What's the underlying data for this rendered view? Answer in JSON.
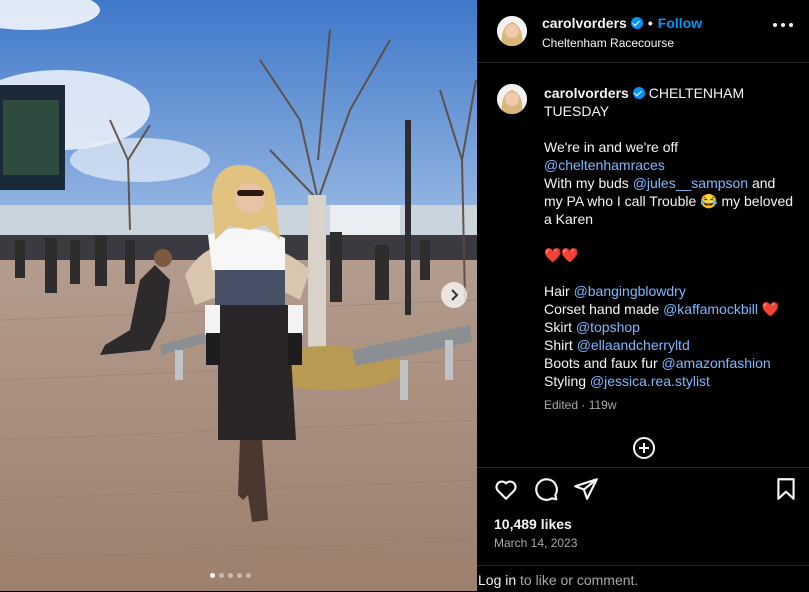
{
  "post": {
    "username": "carolvorders",
    "follow_label": "Follow",
    "separator": "•",
    "location": "Cheltenham Racecourse",
    "caption_title": "CHELTENHAM TUESDAY",
    "caption_lines": [
      {
        "text": "We're in and we're off"
      },
      {
        "mention": "@cheltenhamraces"
      },
      {
        "prefix": "With my buds ",
        "mention": "@jules__sampson",
        "suffix": " and my PA who I call Trouble 😂 my beloved a Karen"
      }
    ],
    "hearts": "❤️❤️",
    "credits": [
      {
        "label": "Hair ",
        "mention": "@bangingblowdry",
        "suffix": ""
      },
      {
        "label": "Corset hand made ",
        "mention": "@kaffamockbill",
        "suffix": " ❤️"
      },
      {
        "label": "Skirt ",
        "mention": "@topshop",
        "suffix": ""
      },
      {
        "label": "Shirt ",
        "mention": "@ellaandcherryltd",
        "suffix": ""
      },
      {
        "label": "Boots and faux fur ",
        "mention": "@amazonfashion",
        "suffix": ""
      },
      {
        "label": "Styling ",
        "mention": "@jessica.rea.stylist",
        "suffix": ""
      }
    ],
    "edited": "Edited",
    "edited_age": "119w",
    "likes": "10,489 likes",
    "date": "March 14, 2023",
    "login_link": "Log in",
    "login_suffix": " to like or comment.",
    "carousel_dots": 5,
    "carousel_active": 1
  },
  "icons": {
    "verified": "verified-badge-icon",
    "more": "more-options-icon",
    "like": "heart-icon",
    "comment": "comment-icon",
    "share": "send-icon",
    "save": "bookmark-icon",
    "load_more": "plus-circle-icon",
    "next": "chevron-right-icon"
  },
  "colors": {
    "accent": "#0095f6",
    "mention": "#7db8ff",
    "muted": "#a8a8a8",
    "background": "#000000"
  }
}
